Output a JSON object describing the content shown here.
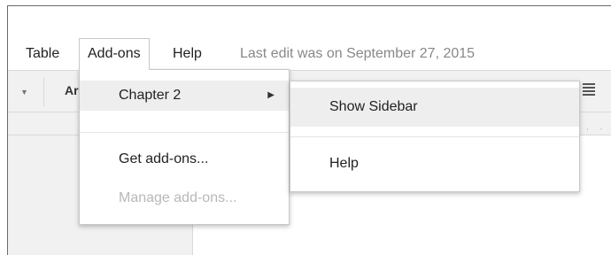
{
  "menubar": {
    "items": [
      {
        "label": "Table"
      },
      {
        "label": "Add-ons"
      },
      {
        "label": "Help"
      }
    ],
    "last_edit": "Last edit was on September 27, 2015"
  },
  "toolbar": {
    "font_name_partial": "Ar",
    "font_caret_icon": "caret-down-icon",
    "align_icon": "align-justify-icon"
  },
  "addons_menu": {
    "items": [
      {
        "label": "Chapter 2",
        "has_submenu": true,
        "state": "highlighted"
      },
      {
        "label": "Get add-ons...",
        "state": "enabled"
      },
      {
        "label": "Manage add-ons...",
        "state": "disabled"
      }
    ],
    "submenu_arrow_icon": "triangle-right-icon"
  },
  "chapter_submenu": {
    "items": [
      {
        "label": "Show Sidebar",
        "state": "highlighted"
      },
      {
        "label": "Help",
        "state": "enabled"
      }
    ]
  },
  "colors": {
    "menu_hover": "#eeeeee",
    "toolbar_bg": "#f1f1f1",
    "disabled_text": "#b8b8b8",
    "muted_text": "#888888"
  }
}
